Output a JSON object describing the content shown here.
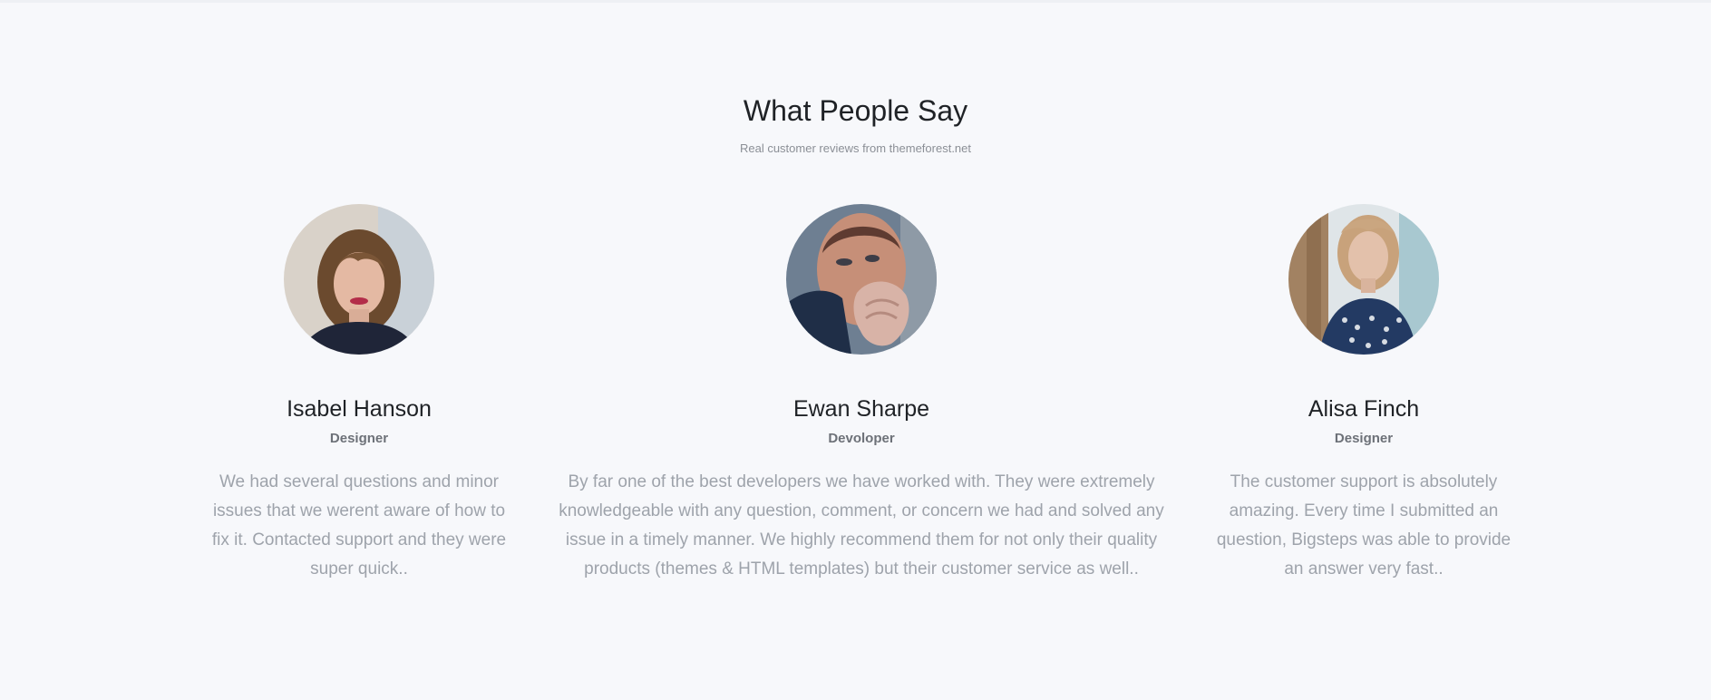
{
  "header": {
    "title": "What People Say",
    "subtitle": "Real customer reviews from themeforest.net"
  },
  "testimonials": [
    {
      "name": "Isabel Hanson",
      "role": "Designer",
      "quote": "We had several questions and minor issues that we werent aware of how to fix it. Contacted support and they were super quick.."
    },
    {
      "name": "Ewan Sharpe",
      "role": "Devoloper",
      "quote": "By far one of the best developers we have worked with. They were extremely knowledgeable with any question, comment, or concern we had and solved any issue in a timely manner. We highly recommend them for not only their quality products (themes & HTML templates) but their customer service as well.."
    },
    {
      "name": "Alisa Finch",
      "role": "Designer",
      "quote": "The customer support is absolutely amazing. Every time I submitted an question, Bigsteps was able to provide an answer very fast.."
    }
  ],
  "colors": {
    "background": "#f7f8fb",
    "heading": "#1f2226",
    "subtitle": "#8b8f96",
    "role": "#6d7178",
    "quote": "#9ea3ab"
  }
}
